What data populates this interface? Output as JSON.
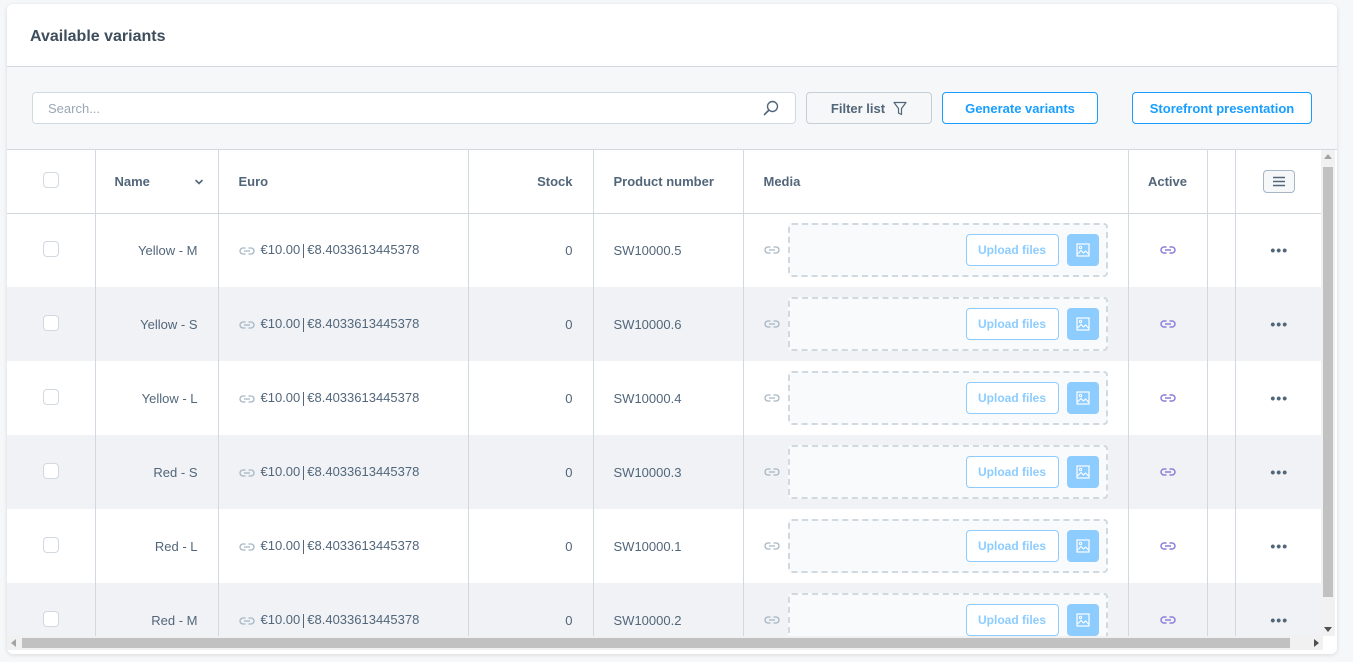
{
  "card": {
    "title": "Available variants"
  },
  "toolbar": {
    "search_placeholder": "Search...",
    "search_value": "",
    "filter_label": "Filter list",
    "generate_label": "Generate variants",
    "storefront_label": "Storefront presentation"
  },
  "table": {
    "columns": {
      "name": "Name",
      "euro": "Euro",
      "stock": "Stock",
      "product_number": "Product number",
      "media": "Media",
      "active": "Active"
    },
    "rows": [
      {
        "name": "Yellow - M",
        "price_gross": "€10.00",
        "price_net": "€8.4033613445378",
        "stock": "0",
        "product_number": "SW10000.5",
        "upload_label": "Upload files"
      },
      {
        "name": "Yellow - S",
        "price_gross": "€10.00",
        "price_net": "€8.4033613445378",
        "stock": "0",
        "product_number": "SW10000.6",
        "upload_label": "Upload files"
      },
      {
        "name": "Yellow - L",
        "price_gross": "€10.00",
        "price_net": "€8.4033613445378",
        "stock": "0",
        "product_number": "SW10000.4",
        "upload_label": "Upload files"
      },
      {
        "name": "Red - S",
        "price_gross": "€10.00",
        "price_net": "€8.4033613445378",
        "stock": "0",
        "product_number": "SW10000.3",
        "upload_label": "Upload files"
      },
      {
        "name": "Red - L",
        "price_gross": "€10.00",
        "price_net": "€8.4033613445378",
        "stock": "0",
        "product_number": "SW10000.1",
        "upload_label": "Upload files"
      },
      {
        "name": "Red - M",
        "price_gross": "€10.00",
        "price_net": "€8.4033613445378",
        "stock": "0",
        "product_number": "SW10000.2",
        "upload_label": "Upload files"
      }
    ]
  },
  "colors": {
    "accent": "#189eff",
    "accent_light": "#8cccff",
    "inherit_link_active": "#8a7fd9",
    "inherit_link_muted": "#a6b6c4",
    "text": "#52667a"
  }
}
